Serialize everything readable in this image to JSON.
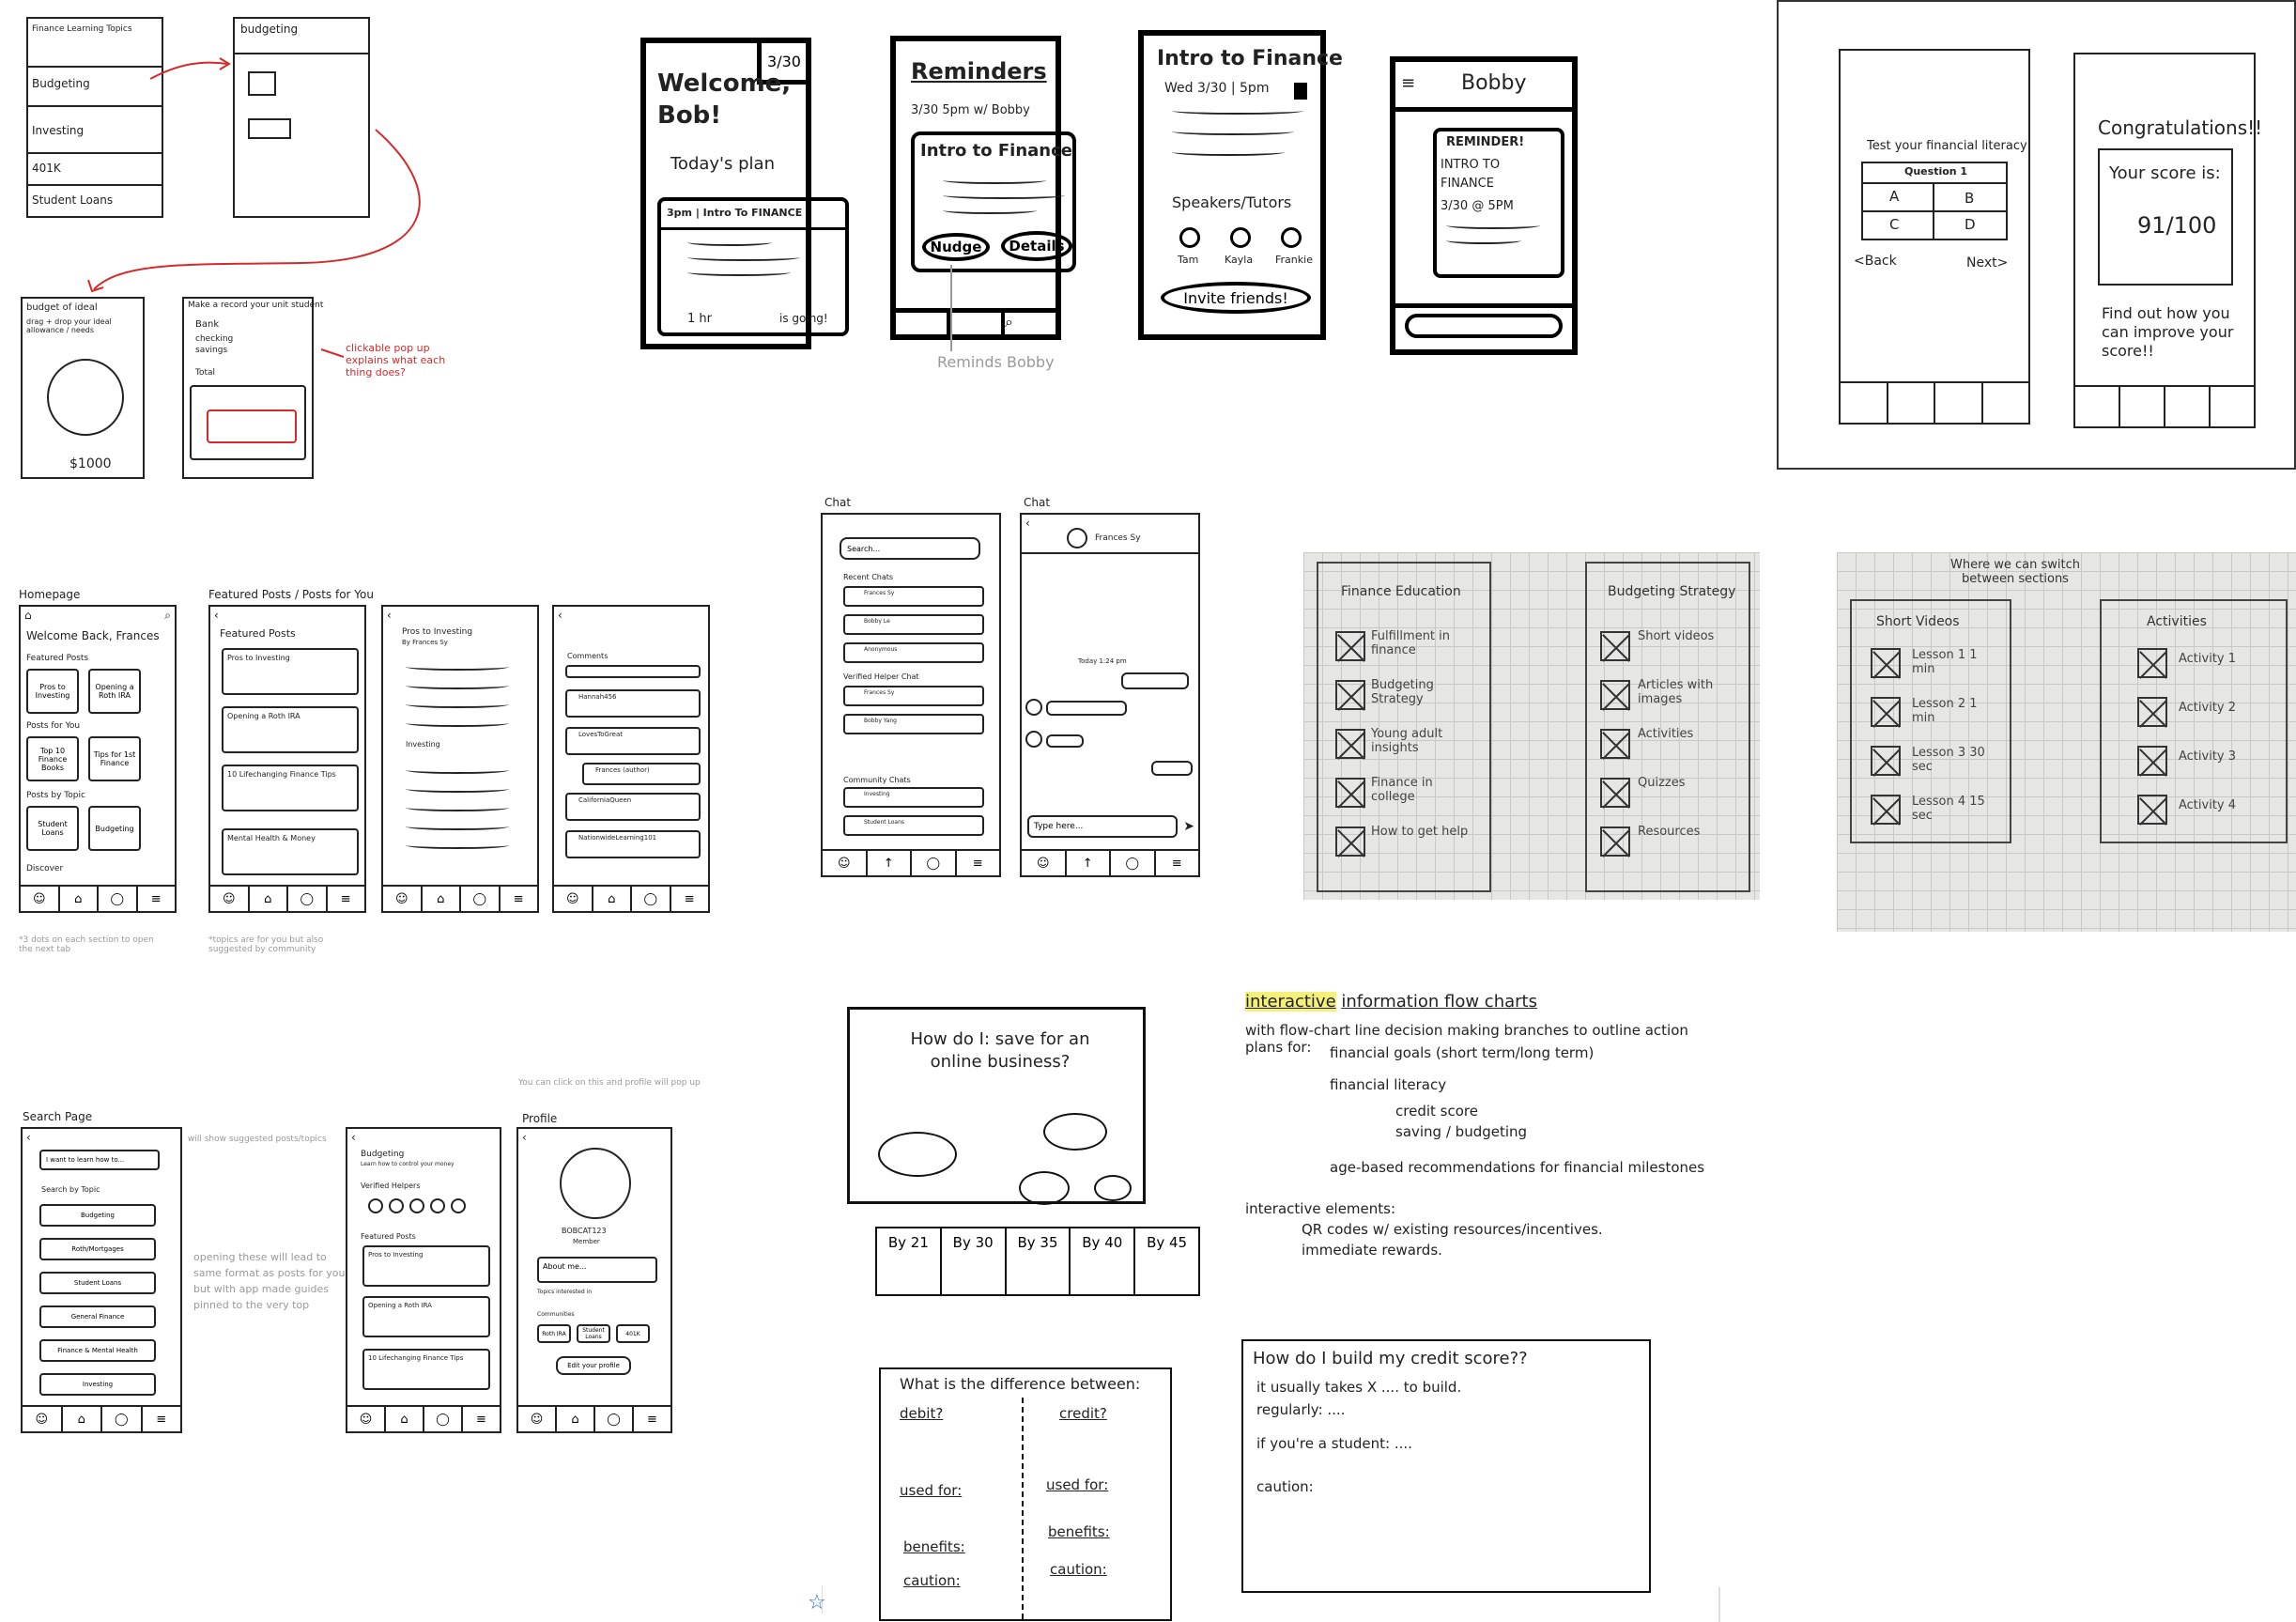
{
  "topics_sketch": {
    "items": [
      "Finance Learning Topics",
      "Budgeting",
      "Investing",
      "401K",
      "Student Loans"
    ],
    "budgeting_box": "budgeting",
    "page2_title": "budget of ideal",
    "page2_note": "drag + drop your ideal allowance / needs",
    "page2_amount": "$1000",
    "page3_title": "Make a record your unit student",
    "page3_rows": [
      "Bank",
      "checking",
      "savings",
      "Total"
    ],
    "red_note": "clickable pop up explains what each thing does?"
  },
  "reminder_phones": {
    "p1": {
      "badge": "3/30",
      "title": "Welcome, Bob!",
      "subtitle": "Today's plan",
      "header": "3pm | Intro To FINANCE",
      "time": "1 hr",
      "going": "is going!"
    },
    "p2": {
      "title": "Reminders",
      "meta": "3/30 5pm w/ Bobby",
      "card_title": "Intro to Finance",
      "btn_nudge": "Nudge",
      "btn_details": "Details",
      "caption": "Reminds Bobby"
    },
    "p3": {
      "title": "Intro to Finance",
      "meta": "Wed 3/30 | 5pm",
      "section": "Speakers/Tutors",
      "speakers": [
        "Tam",
        "Kayla",
        "Frankie"
      ],
      "btn": "Invite friends!"
    },
    "p4": {
      "title": "Bobby",
      "bubble_lines": [
        "REMINDER!",
        "INTRO TO",
        "FINANCE",
        "3/30 @ 5PM"
      ]
    }
  },
  "quiz_phones": {
    "left_title": "Test your financial literacy",
    "question": "Question 1",
    "options": [
      "A",
      "B",
      "C",
      "D"
    ],
    "back": "<Back",
    "next": "Next>",
    "right_title": "Congratulations!!",
    "score_label": "Your score is:",
    "score": "91/100",
    "find_out": "Find out how you can improve your score!!"
  },
  "home_phones": {
    "label_home": "Homepage",
    "label_featured": "Featured Posts / Posts for You",
    "home_title": "Welcome Back, Frances",
    "featured_label": "Featured Posts",
    "featured_tiles": [
      "Pros to Investing",
      "Opening a Roth IRA"
    ],
    "for_you_label": "Posts for You",
    "for_you_tiles": [
      "Top 10 Finance Books",
      "Tips for 1st Finance"
    ],
    "topic_label": "Posts by Topic",
    "topic_tiles": [
      "Student Loans",
      "Budgeting"
    ],
    "discover": "Discover",
    "featured_list": [
      "Pros to Investing",
      "Opening a Roth IRA",
      "10 Lifechanging Finance Tips",
      "Mental Health & Money"
    ],
    "post_title": "Pros to Investing",
    "post_author": "By Frances Sy",
    "post_section": "Investing",
    "comments_label": "Comments",
    "comment_names": [
      "Hannah456",
      "LovesToGreat",
      "Frances (author)",
      "CaliforniaQueen",
      "NationwideLearning101"
    ],
    "note1": "*3 dots on each section to open the next tab",
    "note2": "*topics are for you but also suggested by community"
  },
  "chat_phones": {
    "label1": "Chat",
    "label2": "Chat",
    "search": "Search...",
    "recent": "Recent Chats",
    "recent_items": [
      "Frances Sy",
      "Bobby Le",
      "Anonymous"
    ],
    "verified": "Verified Helper Chat",
    "verified_items": [
      "Frances Sy",
      "Bobby Yang"
    ],
    "community": "Community Chats",
    "community_items": [
      "Investing",
      "Student Loans"
    ],
    "chat_name": "Frances Sy",
    "chat_time": "Today 1:24 pm",
    "type_here": "Type here..."
  },
  "grid_photo_1": {
    "col1_title": "Finance Education",
    "col1": [
      "Fulfillment in finance",
      "Budgeting Strategy",
      "Young adult insights",
      "Finance in college",
      "How to get help"
    ],
    "col2_title": "Budgeting Strategy",
    "col2": [
      "Short videos",
      "Articles with images",
      "Activities",
      "Quizzes",
      "Resources"
    ]
  },
  "grid_photo_2": {
    "annotation": "Where we can switch between sections",
    "col1_title": "Short Videos",
    "col1": [
      "Lesson 1 1 min",
      "Lesson 2 1 min",
      "Lesson 3 30 sec",
      "Lesson 4 15 sec"
    ],
    "col2_title": "Activities",
    "col2": [
      "Activity 1",
      "Activity 2",
      "Activity 3",
      "Activity 4"
    ]
  },
  "search_phones": {
    "label_search": "Search Page",
    "label_profile": "Profile",
    "search_input": "I want to learn how to...",
    "search_note": "will show suggested posts/topics",
    "topic_label": "Search by Topic",
    "topics": [
      "Budgeting",
      "Roth/Mortgages",
      "Student Loans",
      "General Finance",
      "Finance & Mental Health",
      "Investing"
    ],
    "side_note": "opening these will lead to same format as posts for you, but with app made guides pinned to the very top",
    "budgeting_title": "Budgeting",
    "budgeting_sub": "Learn how to control your money",
    "verified_helpers": "Verified Helpers",
    "featured": "Featured Posts",
    "featured_items": [
      "Pros to Investing",
      "Opening a Roth IRA",
      "10 Lifechanging Finance Tips"
    ],
    "click_note": "You can click on this and profile will pop up",
    "profile_name": "BOBCAT123",
    "profile_role": "Member",
    "about": "About me...",
    "topics_label": "Topics interested in",
    "community_label": "Communities",
    "tags": [
      "Roth IRA",
      "Student Loans",
      "401K"
    ],
    "edit": "Edit your profile"
  },
  "flowchart": {
    "question": "How do I: save for an online business?",
    "ages": [
      "By 21",
      "By 30",
      "By 35",
      "By 40",
      "By 45"
    ],
    "compare_title": "What is the difference between:",
    "debit": "debit?",
    "credit": "credit?",
    "rows": [
      "used for:",
      "benefits:",
      "caution:"
    ],
    "notes_title_hl": "interactive",
    "notes_title": "information flow charts",
    "notes": [
      "with flow-chart line decision making branches to outline action plans for:",
      "financial goals (short term/long term)",
      "financial literacy",
      "credit score",
      "saving / budgeting",
      "age-based recommendations for financial milestones",
      "interactive elements:",
      "QR codes w/ existing resources/incentives.",
      "immediate rewards."
    ],
    "credit_q": "How do I build my credit score??",
    "credit_lines": [
      "it usually takes X .... to build.",
      "regularly: ....",
      "if you're a student: ....",
      "caution:"
    ]
  },
  "toolbar": {
    "star": "star-icon"
  }
}
